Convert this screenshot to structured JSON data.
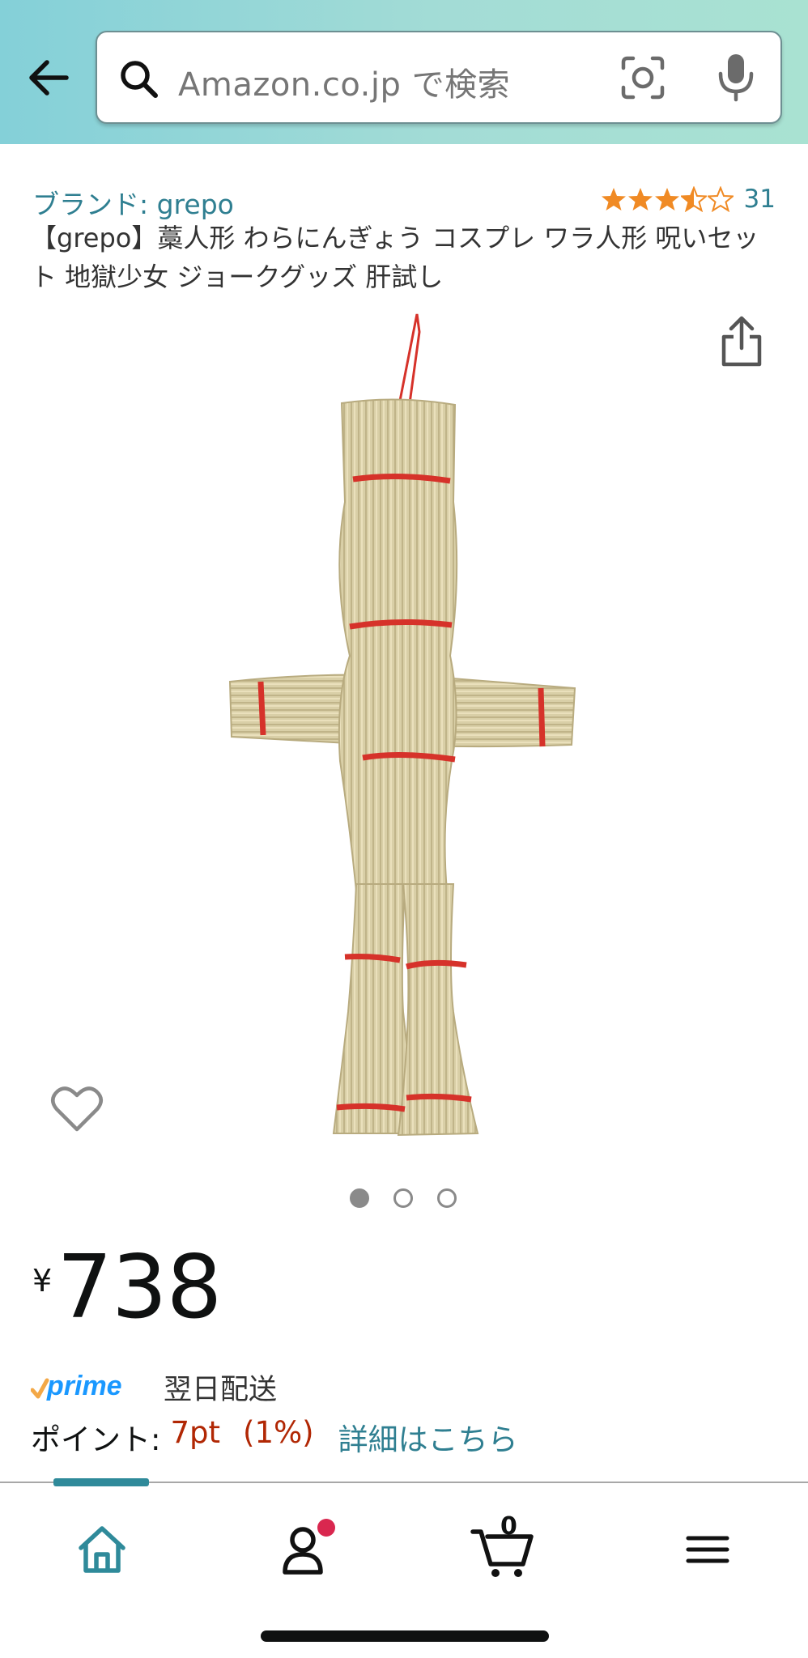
{
  "search": {
    "placeholder": "Amazon.co.jp で検索"
  },
  "product": {
    "brand_label": "ブランド: grepo",
    "rating": 3.5,
    "rating_count": "31",
    "title": "【grepo】藁人形 わらにんぎょう コスプレ ワラ人形 呪いセット 地獄少女 ジョークグッズ 肝試し",
    "image_count": 3,
    "current_image": 1
  },
  "price": {
    "symbol": "¥",
    "value": "738"
  },
  "delivery": {
    "prime_logo": "prime",
    "text": "翌日配送"
  },
  "points": {
    "label": "ポイント:",
    "value": "7pt",
    "percent": "(1%)",
    "link": "詳細はこちら"
  },
  "bottom_nav": {
    "items": [
      "home-icon",
      "account-icon",
      "cart-icon",
      "menu-icon"
    ],
    "active": "home",
    "cart_count": "0"
  },
  "colors": {
    "link": "#2f7f91",
    "price_points": "#b12704",
    "star": "#f08a24",
    "header_start": "#84d0d8",
    "header_end": "#a9e2d2",
    "nav_active": "#2f8a9a"
  }
}
